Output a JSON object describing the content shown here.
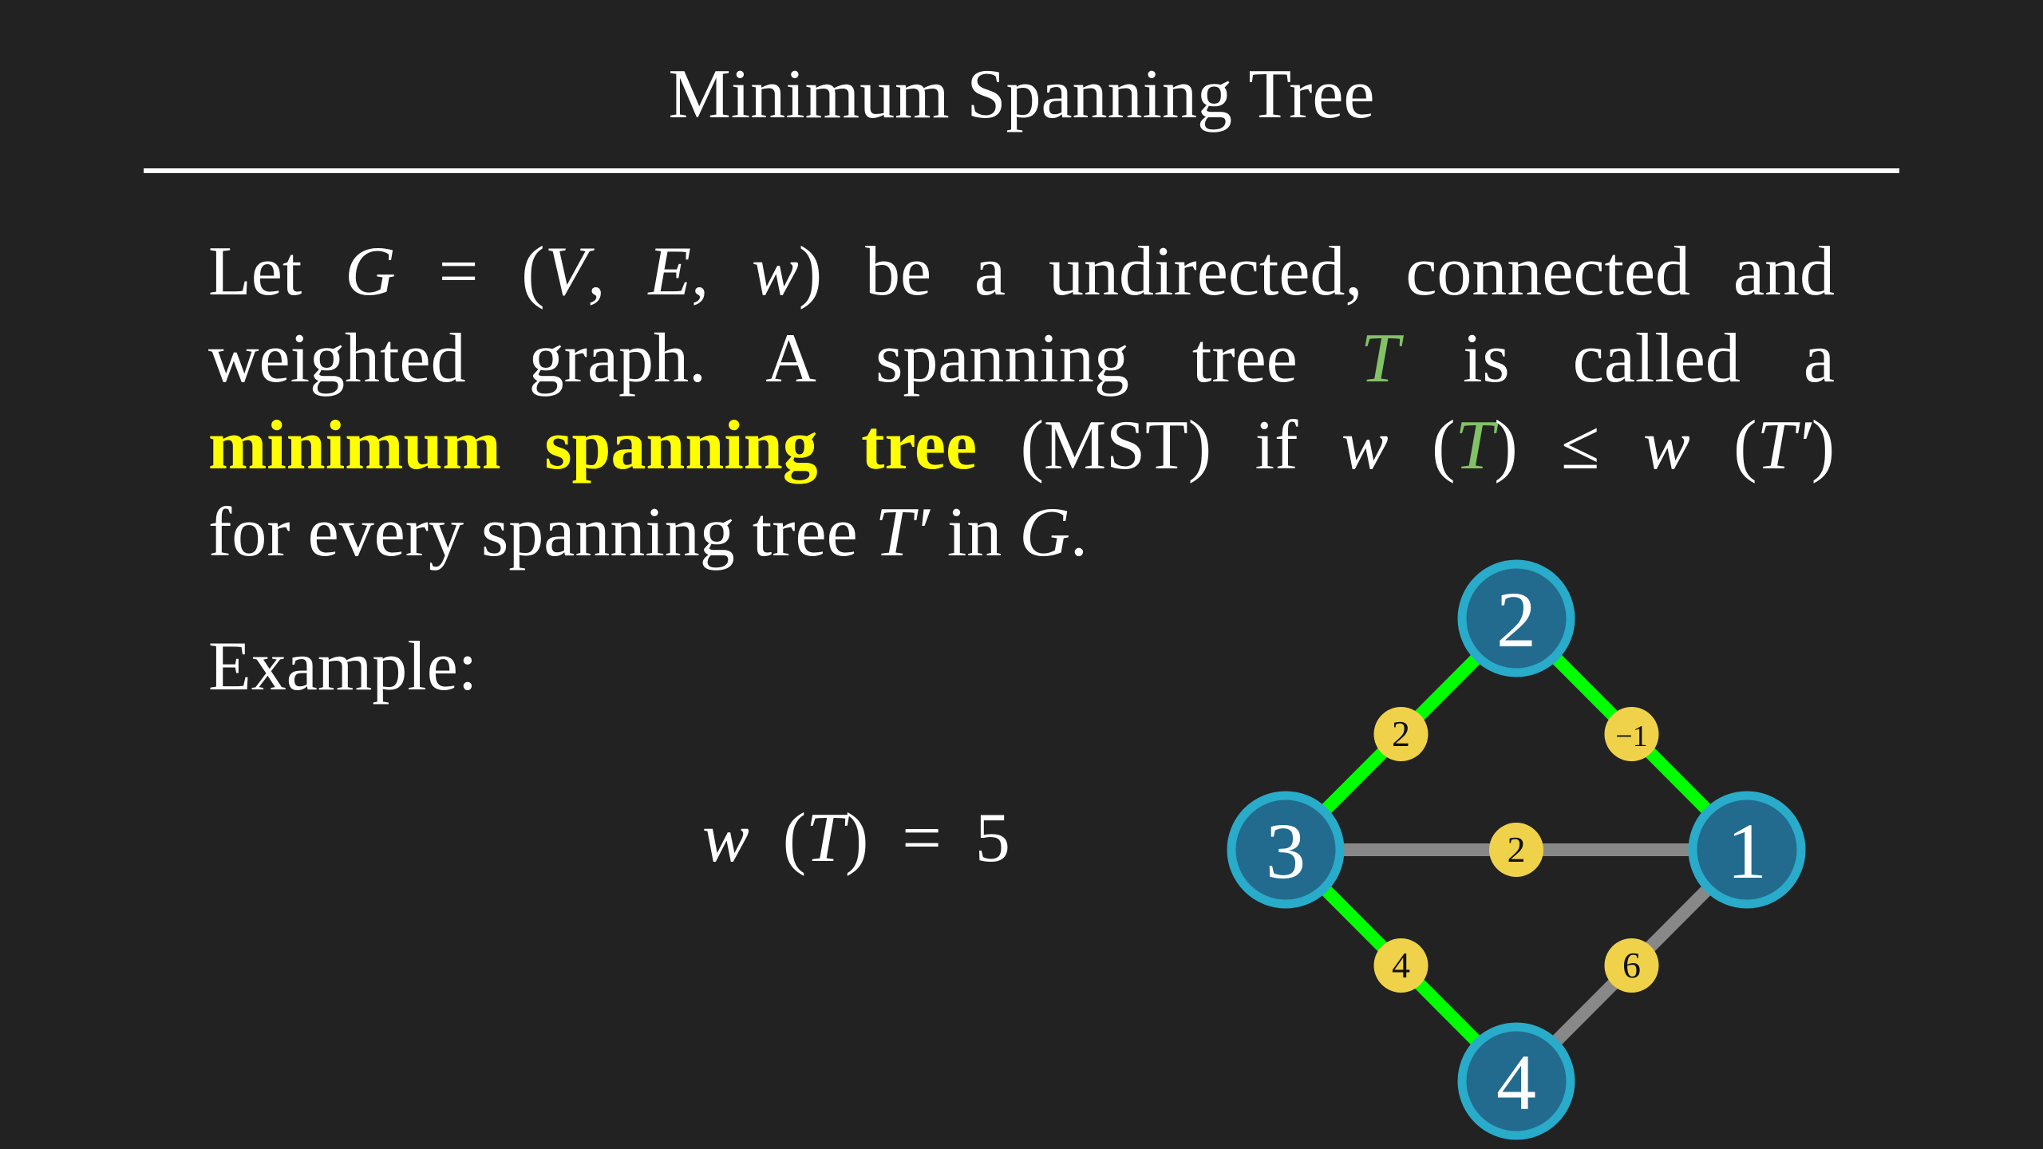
{
  "title": "Minimum Spanning Tree",
  "definition": {
    "line1": {
      "a": "Let ",
      "b": "G",
      "c": " = (",
      "d": "V",
      "e": ", ",
      "f": "E",
      "g": ", ",
      "h": "w",
      "i": ") be a undirected, connected and"
    },
    "line2": {
      "a": "weighted graph.  A spanning tree ",
      "b": "T",
      "c": " is called a"
    },
    "line3": {
      "a": "minimum spanning tree",
      "b": " (MST) if ",
      "c": "w",
      "d": " (",
      "e": "T",
      "f": ") ≤ ",
      "g": "w",
      "h": " (",
      "i": "T′",
      "j": ")"
    },
    "line4": {
      "a": "for every spanning tree ",
      "b": "T′",
      "c": " in ",
      "d": "G",
      "e": "."
    }
  },
  "example_label": "Example:",
  "total": {
    "w": "w",
    "open": " (",
    "T": "T",
    "close": ") ",
    "eq": "= 5"
  },
  "colors": {
    "background": "#222222",
    "node_fill": "#236b8e",
    "node_stroke": "#29abca",
    "mst_edge": "#00ff00",
    "other_edge": "#888888",
    "weight_fill": "#f0d24a",
    "highlight": "#ffff00",
    "T": "#83c167"
  },
  "graph": {
    "nodes": [
      {
        "id": "1",
        "label": "1"
      },
      {
        "id": "2",
        "label": "2"
      },
      {
        "id": "3",
        "label": "3"
      },
      {
        "id": "4",
        "label": "4"
      }
    ],
    "edges": [
      {
        "from": "3",
        "to": "2",
        "weight": "2",
        "in_mst": true
      },
      {
        "from": "2",
        "to": "1",
        "weight": "−1",
        "in_mst": true
      },
      {
        "from": "3",
        "to": "1",
        "weight": "2",
        "in_mst": false
      },
      {
        "from": "3",
        "to": "4",
        "weight": "4",
        "in_mst": true
      },
      {
        "from": "4",
        "to": "1",
        "weight": "6",
        "in_mst": false
      }
    ]
  }
}
